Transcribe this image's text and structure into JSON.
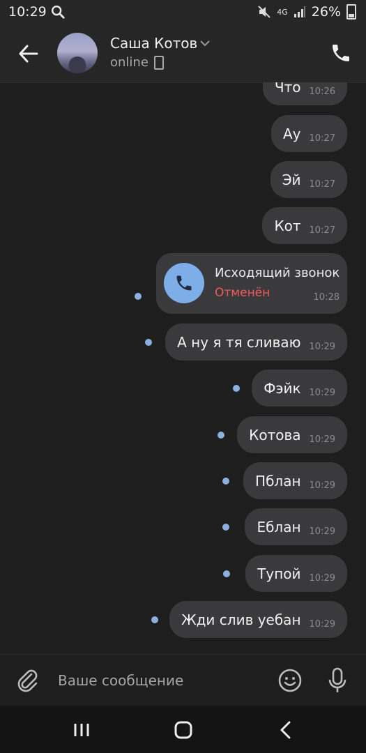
{
  "status_bar": {
    "time": "10:29",
    "battery": "26%",
    "network": "4G"
  },
  "header": {
    "contact_name": "Саша Котов",
    "status": "online"
  },
  "messages": [
    {
      "text": "Что",
      "time": "10:26"
    },
    {
      "text": "Ау",
      "time": "10:27"
    },
    {
      "text": "Эй",
      "time": "10:27"
    },
    {
      "text": "Кот",
      "time": "10:27"
    },
    {
      "text": "А ну я тя сливаю",
      "time": "10:29"
    },
    {
      "text": "Фэйк",
      "time": "10:29"
    },
    {
      "text": "Котова",
      "time": "10:29"
    },
    {
      "text": "Пблан",
      "time": "10:29"
    },
    {
      "text": "Еблан",
      "time": "10:29"
    },
    {
      "text": "Тупой",
      "time": "10:29"
    },
    {
      "text": "Жди слив уебан",
      "time": "10:29"
    }
  ],
  "call": {
    "title": "Исходящий звонок",
    "status": "Отменён",
    "time": "10:28"
  },
  "composer": {
    "placeholder": "Ваше сообщение"
  },
  "colors": {
    "accent": "#7eaee8",
    "cancelled": "#f05a5a",
    "bubble": "#3a3a3c",
    "background": "#1e1e1f"
  }
}
